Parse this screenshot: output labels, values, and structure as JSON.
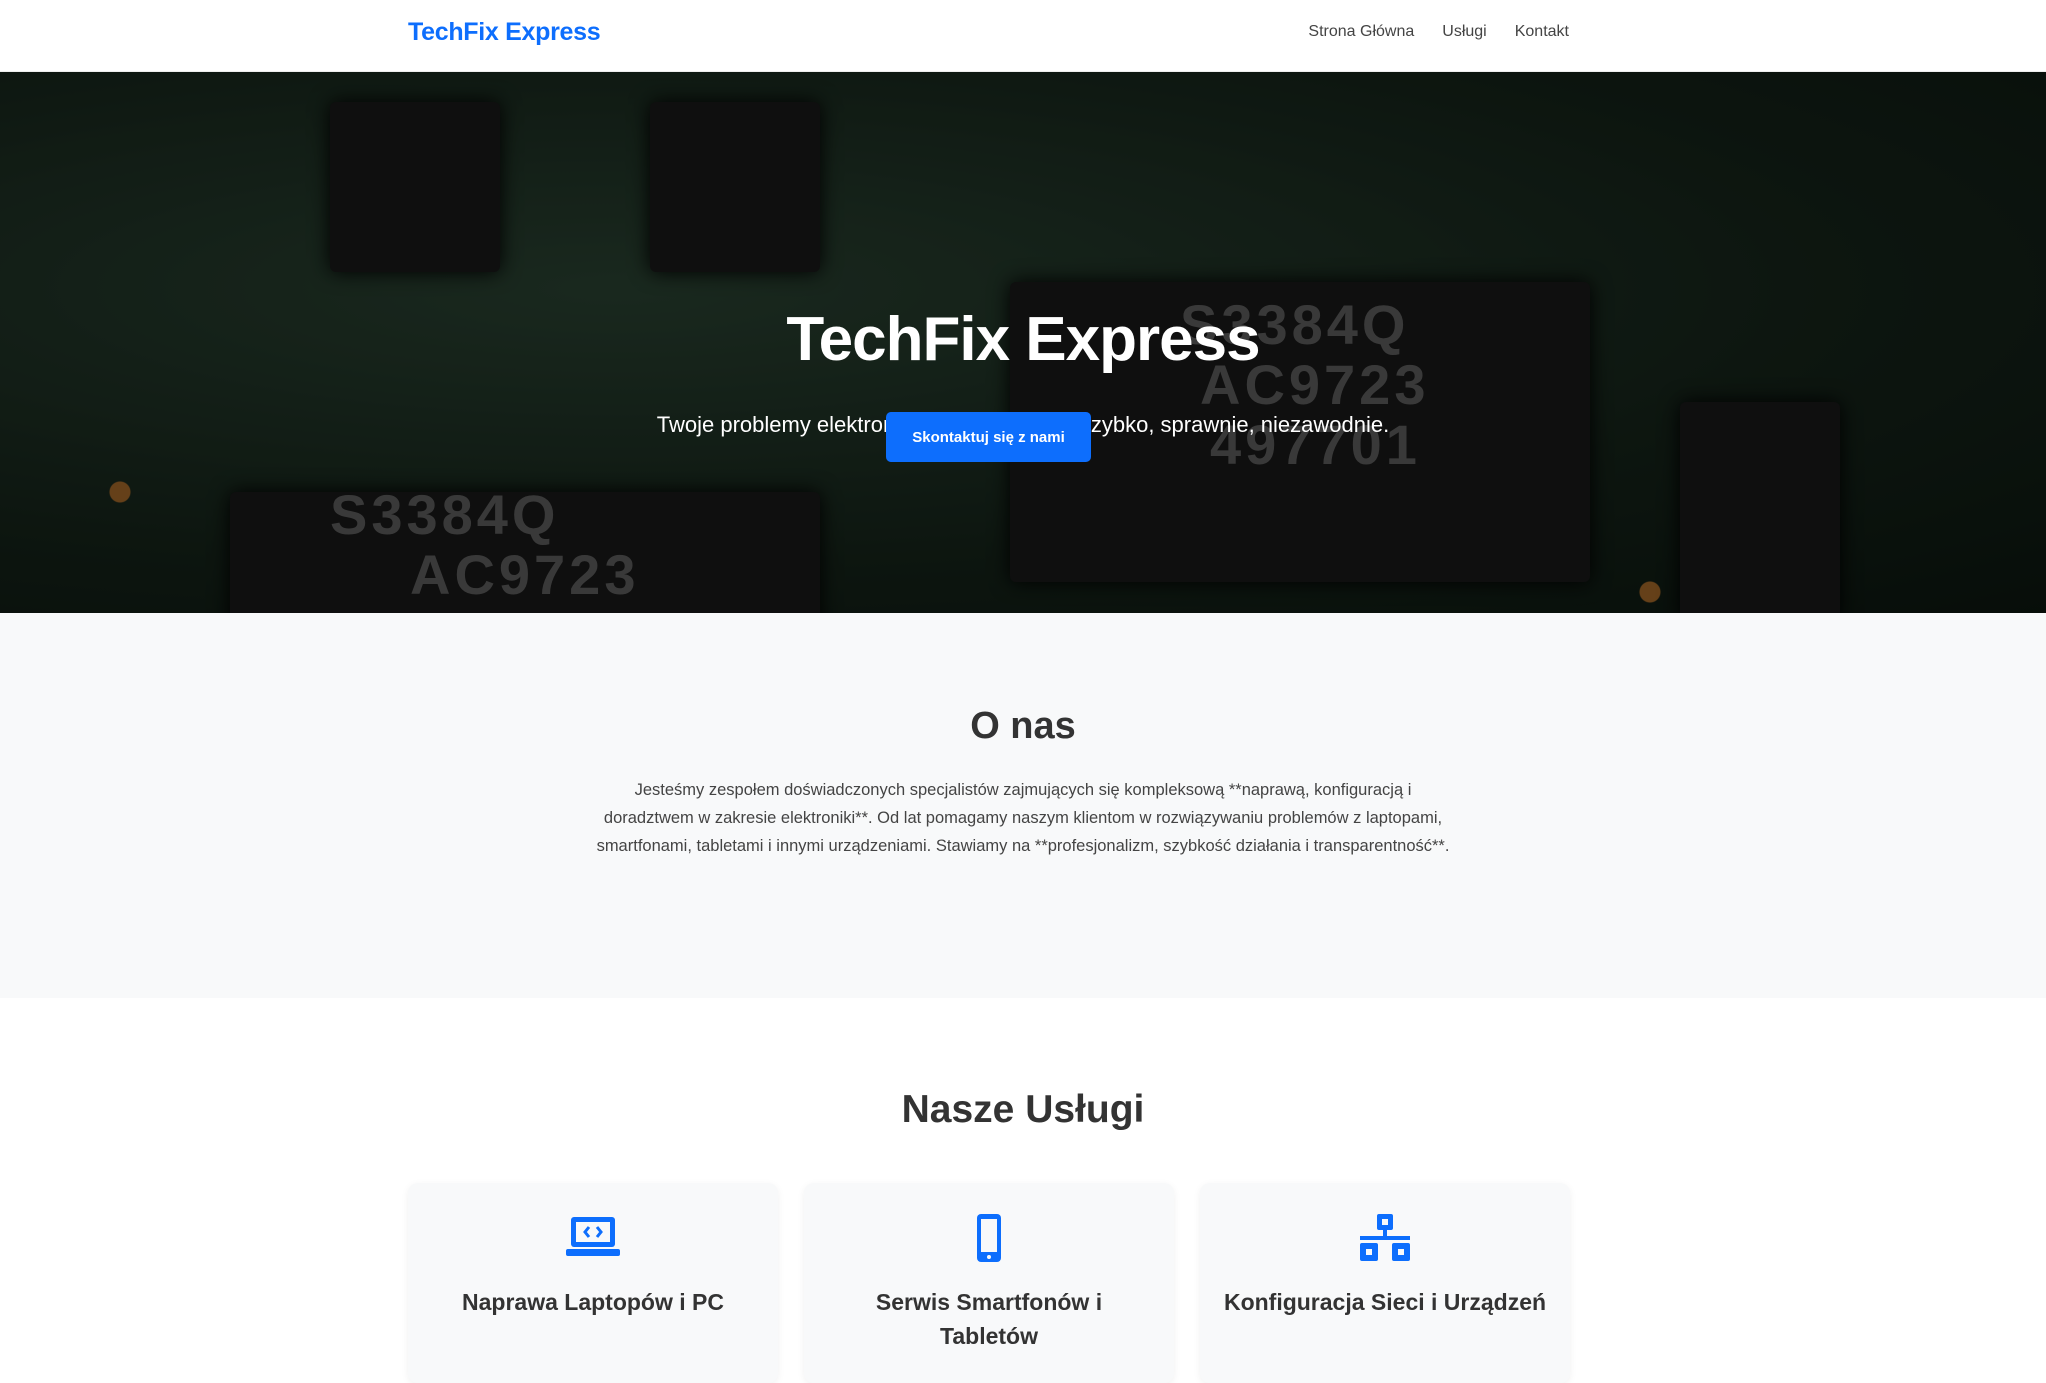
{
  "navbar": {
    "brand": "TechFix Express",
    "links": [
      "Strona Główna",
      "Usługi",
      "Kontakt"
    ]
  },
  "hero": {
    "title": "TechFix Express",
    "subtitle": "Twoje problemy elektroniczne rozwiązane. Szybko, sprawnie, niezawodnie.",
    "button": "Skontaktuj się z nami",
    "chip_labels": [
      "S3384Q",
      "AC9723",
      "497701"
    ]
  },
  "about": {
    "heading": "O nas",
    "text": "Jesteśmy zespołem doświadczonych specjalistów zajmujących się kompleksową **naprawą, konfiguracją i doradztwem w zakresie elektroniki**. Od lat pomagamy naszym klientom w rozwiązywaniu problemów z laptopami, smartfonami, tabletami i innymi urządzeniami. Stawiamy na **profesjonalizm, szybkość działania i transparentność**."
  },
  "services": {
    "heading": "Nasze Usługi",
    "items": [
      {
        "title": "Naprawa Laptopów i PC",
        "icon": "laptop-code-icon"
      },
      {
        "title": "Serwis Smartfonów i Tabletów",
        "icon": "mobile-icon"
      },
      {
        "title": "Konfiguracja Sieci i Urządzeń",
        "icon": "network-icon"
      }
    ]
  },
  "colors": {
    "accent": "#0d6efd",
    "section_bg": "#f8f9fa"
  }
}
